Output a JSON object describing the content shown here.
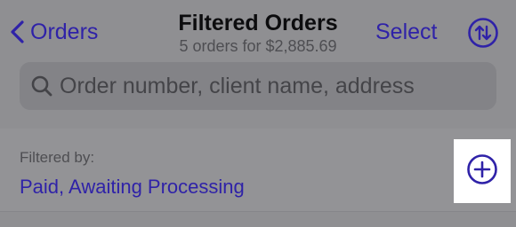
{
  "nav": {
    "back_label": "Orders",
    "title": "Filtered Orders",
    "subtitle": "5 orders for $2,885.69",
    "select_label": "Select",
    "sort_icon": "sort-arrows-icon"
  },
  "search": {
    "placeholder": "Order number, client name, address",
    "value": ""
  },
  "filter": {
    "label": "Filtered by:",
    "value": "Paid, Awaiting Processing",
    "add_icon": "plus-circle-icon"
  },
  "colors": {
    "accent": "#2f22a8",
    "background": "#8f8f92",
    "highlight": "#ffffff"
  }
}
